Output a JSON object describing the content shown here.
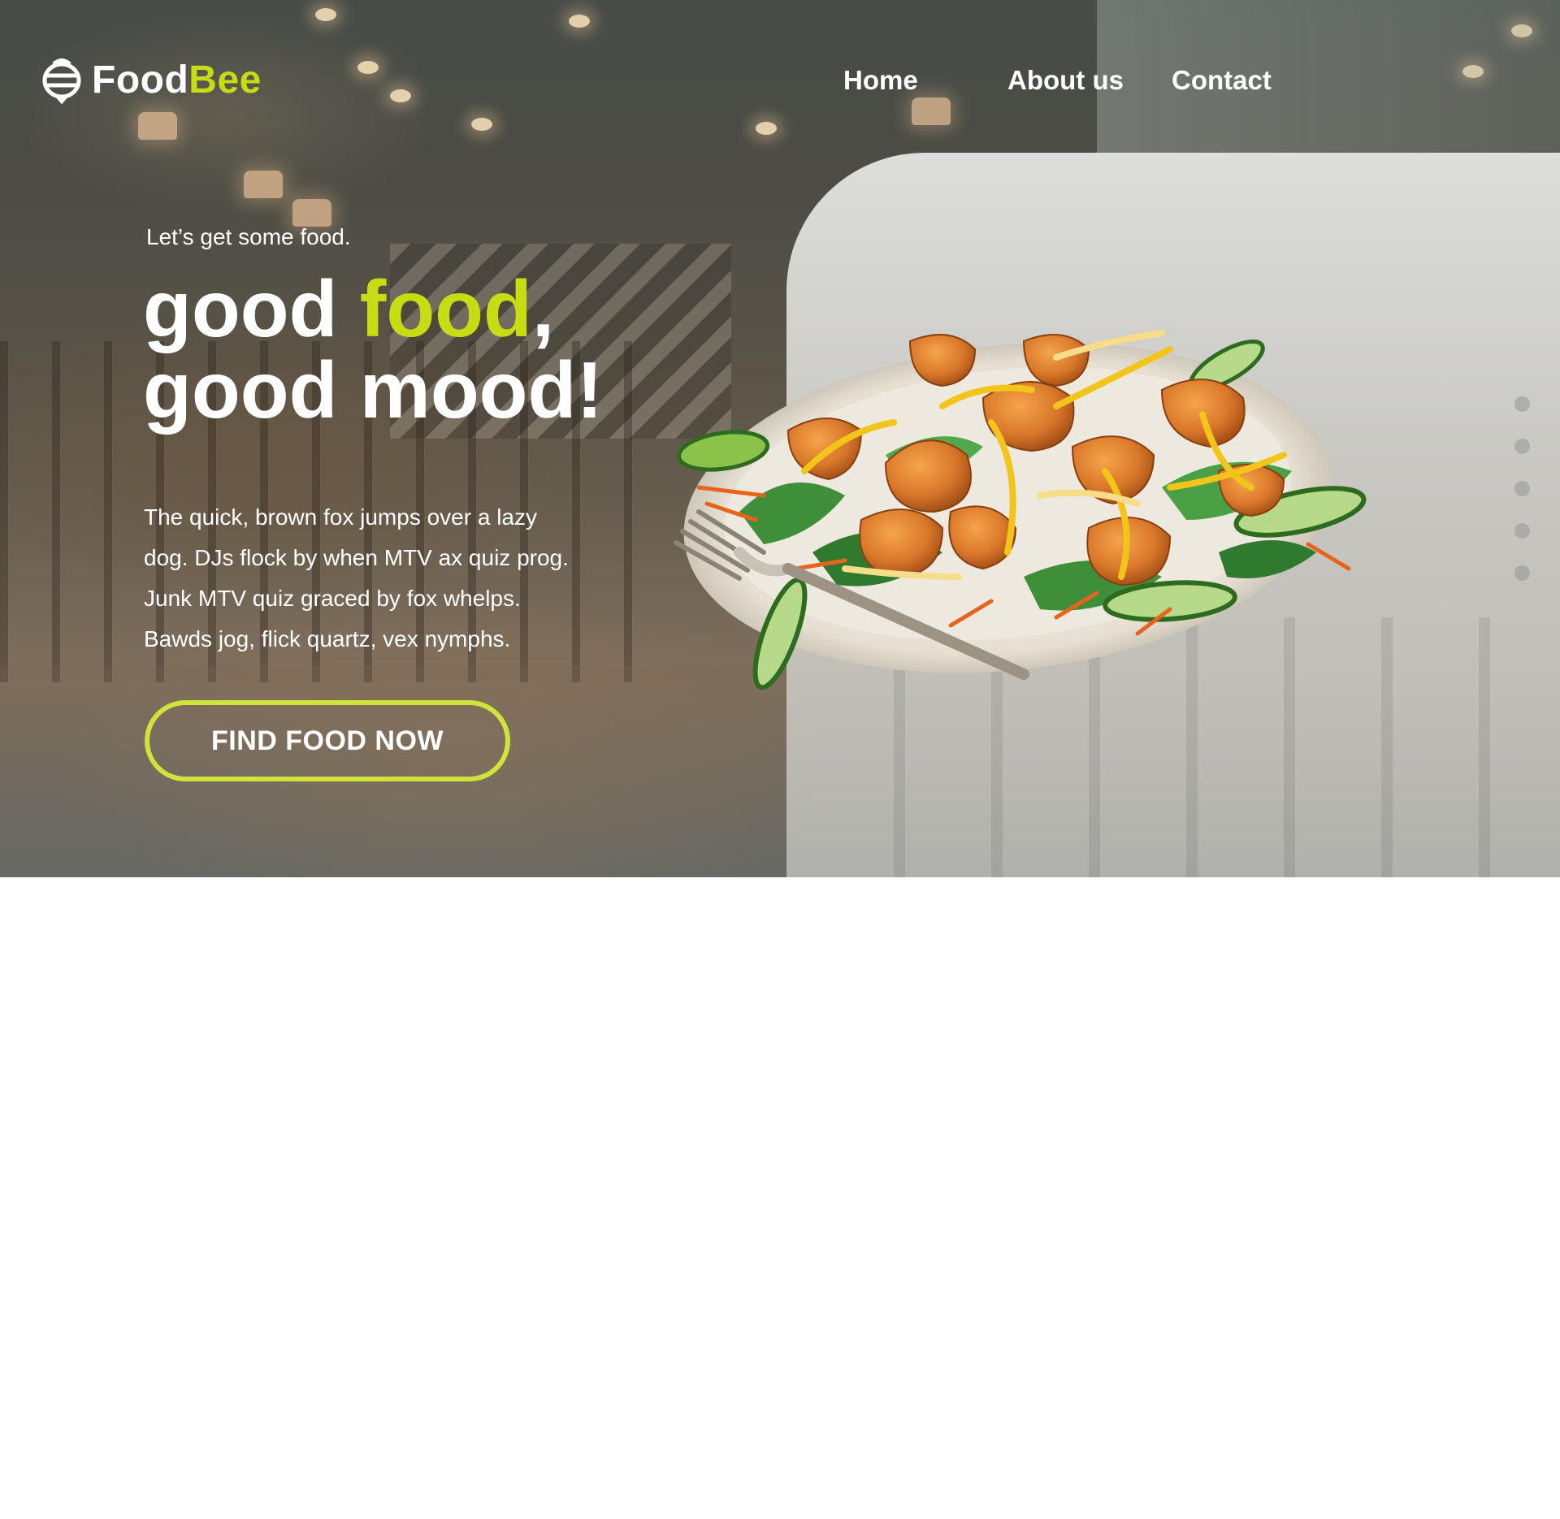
{
  "brand": {
    "name_part1": "Food",
    "name_part2": "Bee",
    "accent_color": "#c8dc14"
  },
  "nav": {
    "items": [
      "Home",
      "About us",
      "Contact"
    ]
  },
  "hero": {
    "kicker": "Let’s get some food.",
    "headline": {
      "line1_a": "good ",
      "line1_accent": "food",
      "line1_b": ",",
      "line2": "good mood!"
    },
    "body_lines": [
      "The quick, brown fox jumps over a lazy",
      "dog. DJs flock by when MTV ax quiz prog.",
      "Junk MTV quiz graced by fox whelps.",
      "Bawds jog, flick quartz, vex nymphs."
    ],
    "cta_label": "FIND FOOD NOW",
    "cta_color": "#cfe33a",
    "image_subject": "salad-plate-with-fork"
  },
  "slider": {
    "dot_count": 5
  },
  "icons": {
    "logo": "bee-icon"
  }
}
